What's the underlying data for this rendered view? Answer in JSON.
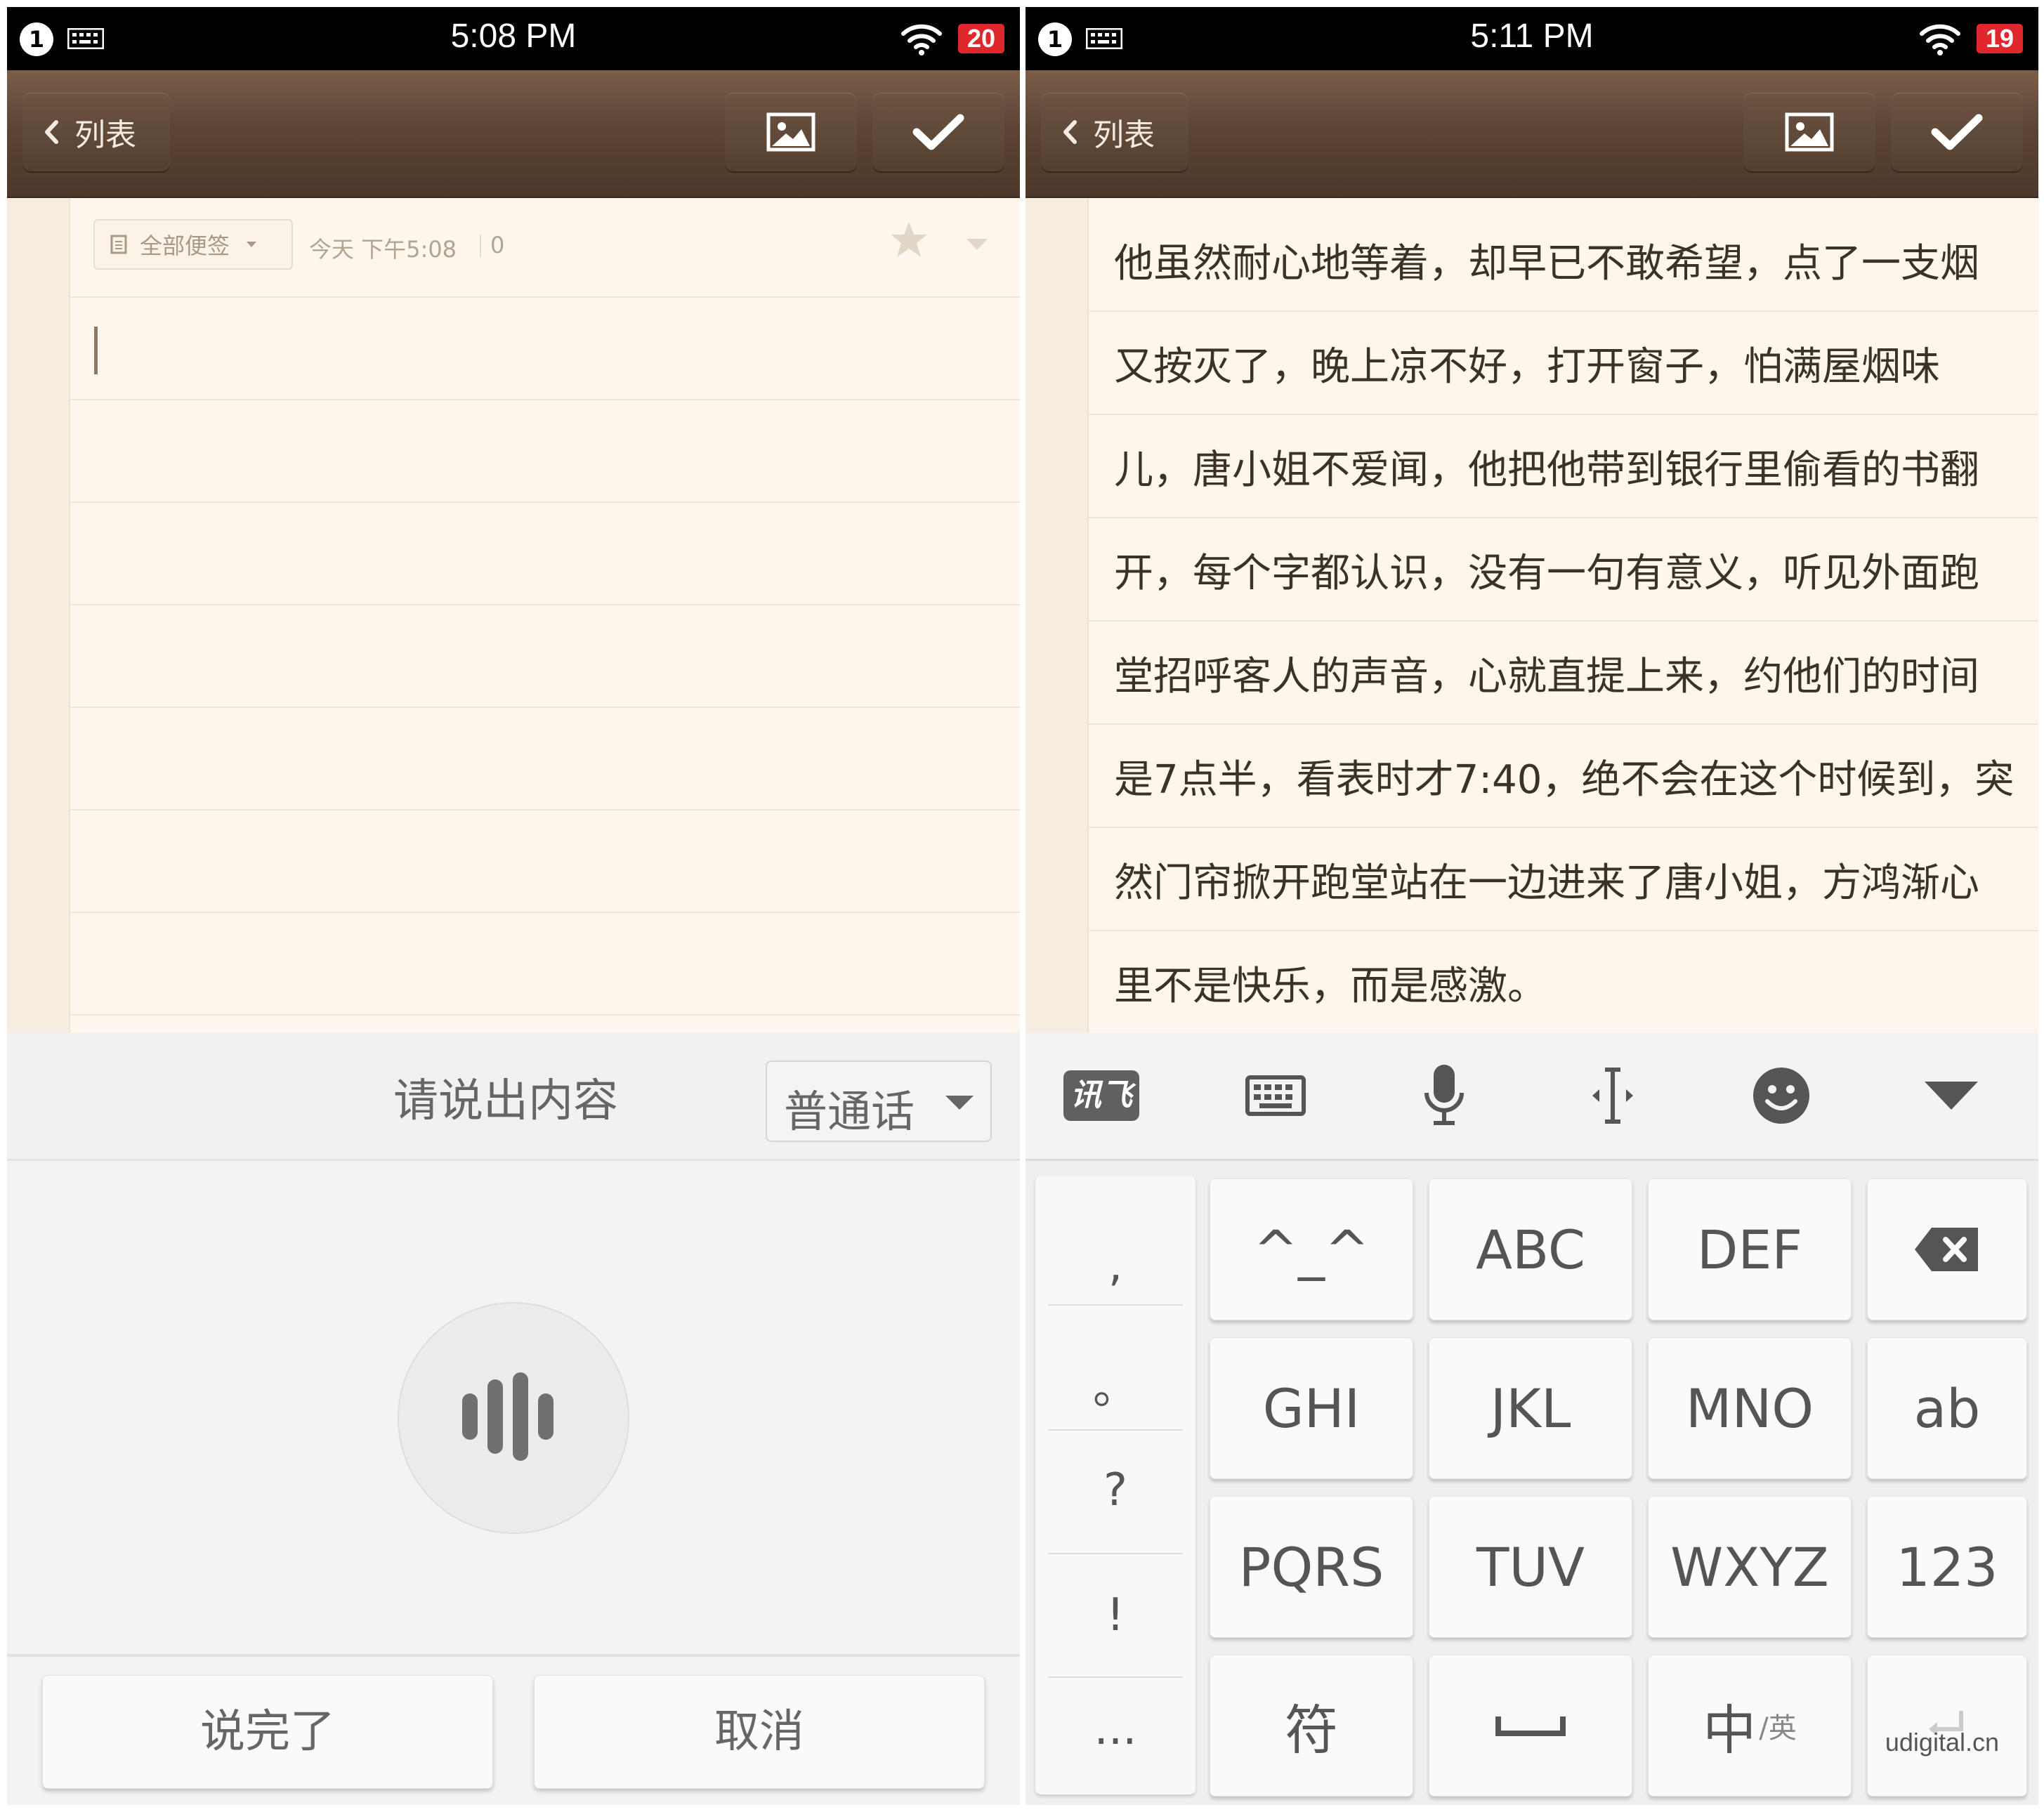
{
  "left": {
    "status": {
      "notification_count": "1",
      "time": "5:08 PM",
      "battery": "20"
    },
    "header": {
      "back_label": "列表"
    },
    "meta": {
      "category": "全部便签",
      "date": "今天 下午5:08",
      "count": "0"
    },
    "voice": {
      "prompt": "请说出内容",
      "language": "普通话",
      "done_label": "说完了",
      "cancel_label": "取消"
    }
  },
  "right": {
    "status": {
      "notification_count": "1",
      "time": "5:11 PM",
      "battery": "19"
    },
    "header": {
      "back_label": "列表"
    },
    "note_lines": [
      "他虽然耐心地等着，却早已不敢希望，点了一支烟",
      "又按灭了，晚上凉不好，打开窗子，怕满屋烟味",
      "儿，唐小姐不爱闻，他把他带到银行里偷看的书翻",
      "开，每个字都认识，没有一句有意义，听见外面跑",
      "堂招呼客人的声音，心就直提上来，约他们的时间",
      "是7点半，看表时才7:40，绝不会在这个时候到，突",
      "然门帘掀开跑堂站在一边进来了唐小姐，方鸿渐心",
      "里不是快乐，而是感激。"
    ],
    "keyboard": {
      "toolbar_logo": "讯飞",
      "punctuation": [
        ",",
        "。",
        "?",
        "!",
        "..."
      ],
      "rows": [
        [
          "^_^",
          "ABC",
          "DEF"
        ],
        [
          "GHI",
          "JKL",
          "MNO",
          "ab"
        ],
        [
          "PQRS",
          "TUV",
          "WXYZ",
          "123"
        ]
      ],
      "bottom": {
        "symbols": "符",
        "lang_main": "中",
        "lang_sub": "/英"
      }
    }
  },
  "watermark": "udigital.cn",
  "colors": {
    "header_brown": "#5c4435",
    "paper": "#fdf6ec",
    "battery_red": "#e0282c"
  },
  "icons": [
    "keyboard-icon",
    "wifi-icon",
    "chevron-left-icon",
    "image-icon",
    "check-icon",
    "star-icon",
    "microphone-icon",
    "cursor-move-icon",
    "emoji-icon",
    "hide-keyboard-icon",
    "backspace-icon",
    "space-icon"
  ]
}
